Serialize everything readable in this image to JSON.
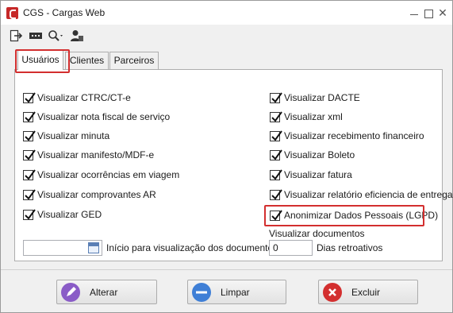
{
  "window": {
    "title": "CGS - Cargas Web"
  },
  "tabs": [
    {
      "label": "Usuários",
      "active": true
    },
    {
      "label": "Clientes",
      "active": false
    },
    {
      "label": "Parceiros",
      "active": false
    }
  ],
  "left_checkboxes": [
    {
      "label": "Visualizar CTRC/CT-e",
      "checked": true
    },
    {
      "label": "Visualizar nota fiscal de serviço",
      "checked": true
    },
    {
      "label": "Visualizar minuta",
      "checked": true
    },
    {
      "label": "Visualizar manifesto/MDF-e",
      "checked": true
    },
    {
      "label": "Visualizar ocorrências em viagem",
      "checked": true
    },
    {
      "label": "Visualizar comprovantes AR",
      "checked": true
    },
    {
      "label": "Visualizar GED",
      "checked": true
    }
  ],
  "right_checkboxes": [
    {
      "label": "Visualizar DACTE",
      "checked": true
    },
    {
      "label": "Visualizar xml",
      "checked": true
    },
    {
      "label": "Visualizar recebimento financeiro",
      "checked": true
    },
    {
      "label": "Visualizar Boleto",
      "checked": true
    },
    {
      "label": "Visualizar fatura",
      "checked": true
    },
    {
      "label": "Visualizar relatório eficiencia de entrega",
      "checked": true
    },
    {
      "label": "Anonimizar Dados Pessoais (LGPD)",
      "checked": true
    }
  ],
  "date_field": {
    "value": "",
    "label": "Início para visualização dos documentos"
  },
  "retro_field": {
    "caption": "Visualizar documentos",
    "value": "0",
    "suffix": "Dias retroativos"
  },
  "buttons": {
    "alterar": "Alterar",
    "limpar": "Limpar",
    "excluir": "Excluir"
  },
  "colors": {
    "highlight": "#d32f2f",
    "app_icon": "#c62828",
    "limpar_icon": "#3f7fd6",
    "excluir_icon": "#d32f2f",
    "alterar_icon": "#8a5cc7"
  }
}
